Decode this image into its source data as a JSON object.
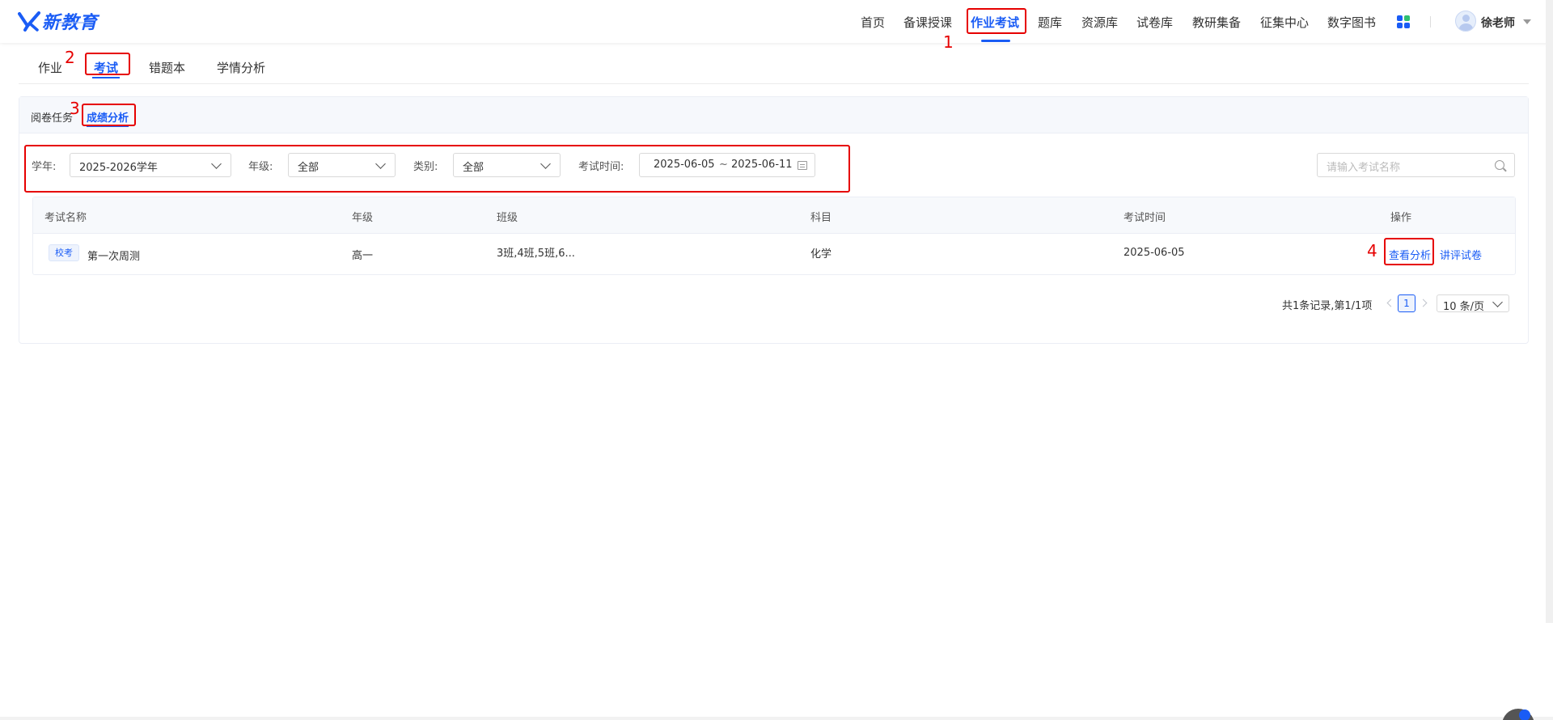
{
  "brand": {
    "name": "新教育"
  },
  "nav": {
    "items": [
      "首页",
      "备课授课",
      "作业考试",
      "题库",
      "资源库",
      "试卷库",
      "教研集备",
      "征集中心",
      "数字图书"
    ],
    "active_index": 2,
    "user": "徐老师"
  },
  "tabs": {
    "items": [
      "作业",
      "考试",
      "错题本",
      "学情分析"
    ],
    "active_index": 1
  },
  "subtabs": {
    "items": [
      "阅卷任务",
      "成绩分析"
    ],
    "active_index": 1
  },
  "filters": {
    "year_label": "学年:",
    "year_value": "2025-2026学年",
    "grade_label": "年级:",
    "grade_value": "全部",
    "category_label": "类别:",
    "category_value": "全部",
    "time_label": "考试时间:",
    "date_start": "2025-06-05",
    "date_sep": "~",
    "date_end": "2025-06-11",
    "search_placeholder": "请输入考试名称"
  },
  "table": {
    "headers": [
      "考试名称",
      "年级",
      "班级",
      "科目",
      "考试时间",
      "操作"
    ],
    "rows": [
      {
        "tag": "校考",
        "name": "第一次周测",
        "grade": "高一",
        "classes": "3班,4班,5班,6...",
        "subject": "化学",
        "date": "2025-06-05",
        "actions": [
          "查看分析",
          "讲评试卷"
        ]
      }
    ]
  },
  "pagination": {
    "summary": "共1条记录,第1/1项",
    "current": "1",
    "page_size": "10 条/页"
  },
  "annotations": [
    "1",
    "2",
    "3",
    "4"
  ],
  "colors": {
    "primary": "#1a5cf5",
    "annotation": "#e60000"
  }
}
